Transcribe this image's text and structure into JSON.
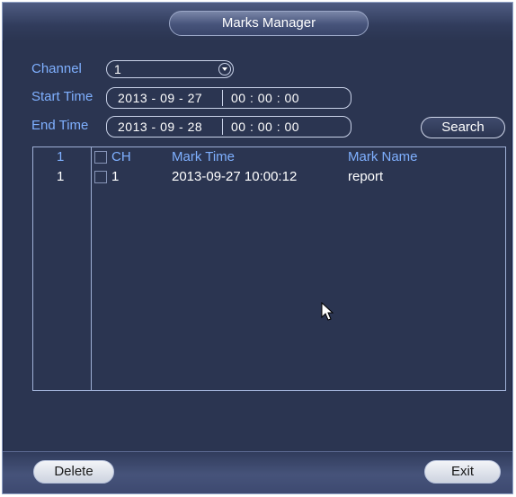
{
  "window": {
    "title": "Marks Manager"
  },
  "filters": {
    "channel_label": "Channel",
    "channel_value": "1",
    "start_time_label": "Start Time",
    "start_date": "2013 - 09 - 27",
    "start_time": "00 : 00 : 00",
    "end_time_label": "End Time",
    "end_date": "2013 - 09 - 28",
    "end_time": "00 : 00 : 00",
    "search_label": "Search"
  },
  "table": {
    "header": {
      "index": "1",
      "ch": "CH",
      "mark_time": "Mark Time",
      "mark_name": "Mark Name"
    },
    "rows": [
      {
        "index": "1",
        "ch": "1",
        "mark_time": "2013-09-27 10:00:12",
        "mark_name": "report"
      }
    ]
  },
  "footer": {
    "delete_label": "Delete",
    "exit_label": "Exit"
  },
  "icons": {
    "cursor": "arrow-pointer-icon",
    "dropdown": "chevron-down-icon"
  },
  "colors": {
    "background": "#2b3551",
    "label": "#7fb0ff",
    "text": "#ffffff",
    "border": "#9fb0d6"
  }
}
